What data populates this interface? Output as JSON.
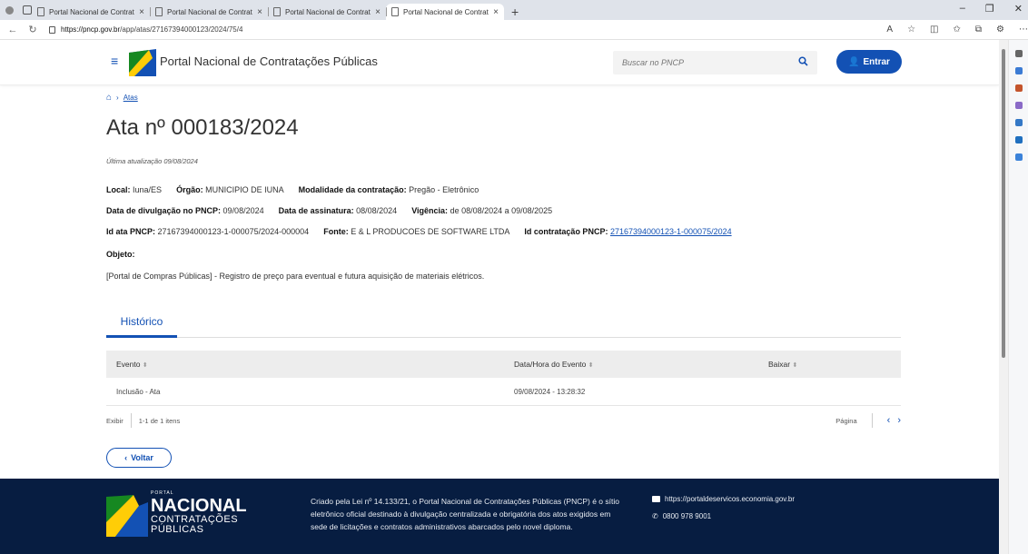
{
  "browser": {
    "tabs": [
      {
        "title": "Portal Nacional de Contratações"
      },
      {
        "title": "Portal Nacional de Contratações"
      },
      {
        "title": "Portal Nacional de Contratações"
      },
      {
        "title": "Portal Nacional de Contratações"
      }
    ],
    "url_host": "https://pncp.gov.br",
    "url_path": "/app/atas/27167394000123/2024/75/4"
  },
  "header": {
    "site_title": "Portal Nacional de Contratações Públicas",
    "search_placeholder": "Buscar no PNCP",
    "login_label": "Entrar"
  },
  "breadcrumb": {
    "item": "Atas"
  },
  "page": {
    "title": "Ata nº 000183/2024",
    "updated": "Última atualização 09/08/2024"
  },
  "details": {
    "local_label": "Local:",
    "local_value": "Iuna/ES",
    "orgao_label": "Órgão:",
    "orgao_value": "MUNICIPIO DE IUNA",
    "modalidade_label": "Modalidade da contratação:",
    "modalidade_value": "Pregão - Eletrônico",
    "divulgacao_label": "Data de divulgação no PNCP:",
    "divulgacao_value": "09/08/2024",
    "assinatura_label": "Data de assinatura:",
    "assinatura_value": "08/08/2024",
    "vigencia_label": "Vigência:",
    "vigencia_value": "de 08/08/2024 a 09/08/2025",
    "idata_label": "Id ata PNCP:",
    "idata_value": "27167394000123-1-000075/2024-000004",
    "fonte_label": "Fonte:",
    "fonte_value": "E & L PRODUCOES DE SOFTWARE LTDA",
    "idcontratacao_label": "Id contratação PNCP:",
    "idcontratacao_value": "27167394000123-1-000075/2024",
    "objeto_label": "Objeto:",
    "objeto_value": "[Portal de Compras Públicas] - Registro de preço para eventual e futura aquisição de materiais elétricos."
  },
  "history": {
    "tab_label": "Histórico",
    "columns": [
      "Evento",
      "Data/Hora do Evento",
      "Baixar"
    ],
    "rows": [
      {
        "evento": "Inclusão - Ata",
        "data": "09/08/2024 - 13:28:32",
        "baixar": ""
      }
    ],
    "pager": {
      "exibir": "Exibir",
      "range": "1-1 de 1 itens",
      "pagina": "Página"
    }
  },
  "back_label": "Voltar",
  "footer": {
    "brand_small": "PORTAL",
    "brand_big": "NACIONAL",
    "brand_mid1": "CONTRATAÇÕES",
    "brand_mid2": "PÚBLICAS",
    "description": "Criado pela Lei nº 14.133/21, o Portal Nacional de Contratações Públicas (PNCP) é o sítio eletrônico oficial destinado à divulgação centralizada e obrigatória dos atos exigidos em sede de licitações e contratos administrativos abarcados pelo novel diploma.",
    "link": "https://portaldeservicos.economia.gov.br",
    "phone": "0800 978 9001"
  },
  "colors": {
    "primary": "#1351b4",
    "footer": "#071d41"
  }
}
